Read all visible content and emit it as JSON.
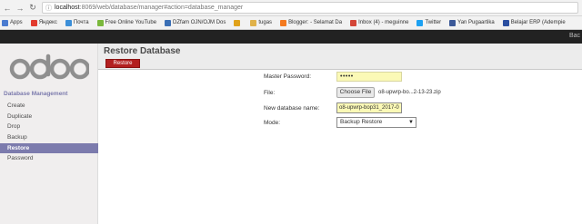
{
  "browser": {
    "url_host": "localhost",
    "url_path": ":8069/web/database/manager#action=database_manager",
    "bookmarks": [
      {
        "label": "Apps",
        "color": "#4a7bd0"
      },
      {
        "label": "Яндекс",
        "color": "#e23b2e"
      },
      {
        "label": "Почта",
        "color": "#3c8fd8"
      },
      {
        "label": "Free Online YouTube",
        "color": "#7ab83c"
      },
      {
        "label": "DZfam OJN/OJM Dos",
        "color": "#3a6fb5"
      },
      {
        "label": "",
        "color": "#e0a21a"
      },
      {
        "label": "tugas",
        "color": "#e0b24a"
      },
      {
        "label": "Blogger: - Selamat Da",
        "color": "#f47a1f"
      },
      {
        "label": "Inbox (4) - meguinne",
        "color": "#d44638"
      },
      {
        "label": "Twitter",
        "color": "#1da1f2"
      },
      {
        "label": "Yan Pugaartika",
        "color": "#3b5998"
      },
      {
        "label": "Belajar ERP (Adempie",
        "color": "#2b4fa1"
      }
    ]
  },
  "topbar": {
    "right_text": "Bac"
  },
  "sidebar": {
    "title": "Database Management",
    "items": [
      {
        "label": "Create",
        "active": false
      },
      {
        "label": "Duplicate",
        "active": false
      },
      {
        "label": "Drop",
        "active": false
      },
      {
        "label": "Backup",
        "active": false
      },
      {
        "label": "Restore",
        "active": true
      },
      {
        "label": "Password",
        "active": false
      }
    ]
  },
  "main": {
    "title": "Restore Database",
    "restore_button": "Restore"
  },
  "form": {
    "master_password_label": "Master Password:",
    "master_password_value": "•••••",
    "file_label": "File:",
    "choose_file_button": "Choose File",
    "file_name": "o8-upwrp-bo...2-13-23.zip",
    "new_db_label": "New database name:",
    "new_db_value": "o8-upwrp-bop31_2017-0",
    "mode_label": "Mode:",
    "mode_value": "Backup Restore"
  },
  "colors": {
    "accent": "#7c7bad",
    "restore_button": "#b32020",
    "input_highlight": "#fbf9b6",
    "topbar": "#222222"
  }
}
